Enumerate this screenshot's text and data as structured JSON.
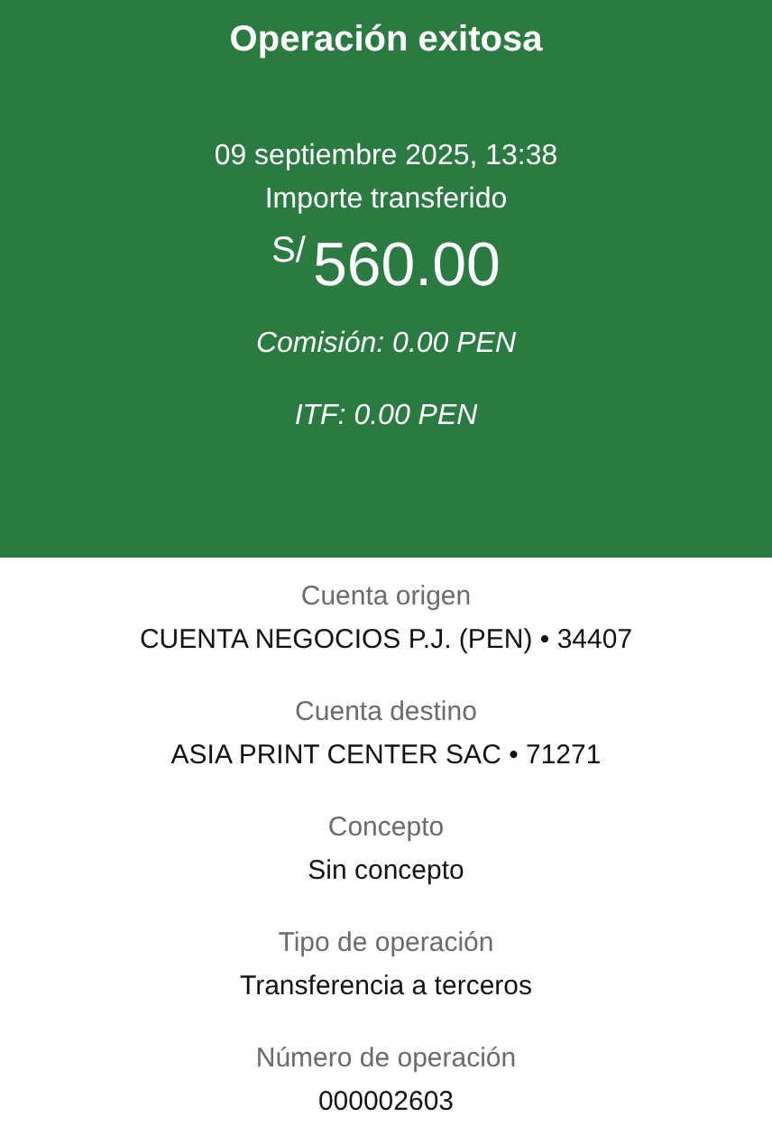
{
  "header": {
    "title": "Operación exitosa",
    "date": "09 septiembre 2025, 13:38",
    "amount_label": "Importe transferido",
    "currency": "S/",
    "amount": "560.00",
    "fees": [
      "Comisión: 0.00 PEN",
      "ITF: 0.00 PEN"
    ]
  },
  "details": [
    {
      "label": "Cuenta origen",
      "value": "CUENTA NEGOCIOS P.J. (PEN) • 34407"
    },
    {
      "label": "Cuenta destino",
      "value": "ASIA PRINT CENTER SAC • 71271"
    },
    {
      "label": "Concepto",
      "value": "Sin concepto"
    },
    {
      "label": "Tipo de operación",
      "value": "Transferencia a terceros"
    },
    {
      "label": "Número de operación",
      "value": "000002603"
    }
  ]
}
